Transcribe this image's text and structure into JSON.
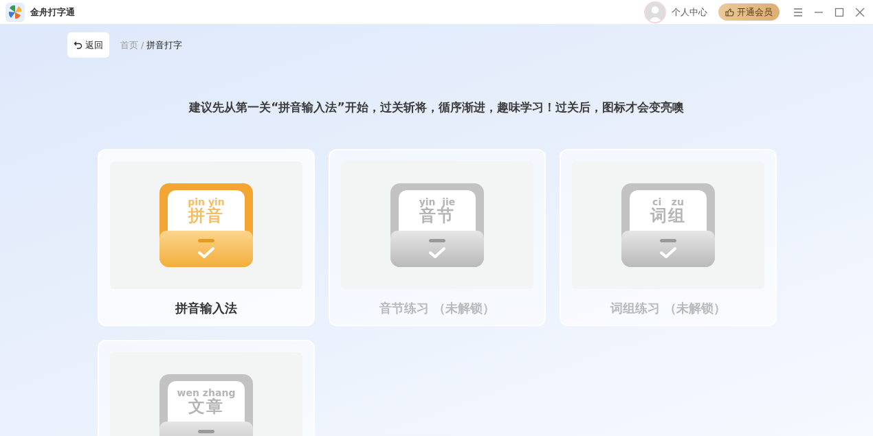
{
  "app": {
    "title": "金舟打字通"
  },
  "header": {
    "user_label": "个人中心",
    "vip_button": "开通会员"
  },
  "back_button": "返回",
  "breadcrumb_separator": "/",
  "breadcrumb": [
    {
      "label": "首页",
      "current": false
    },
    {
      "label": "拼音打字",
      "current": true
    }
  ],
  "hint": "建议先从第一关“拼音输入法”开始，过关斩将，循序渐进，趣味学习！过关后，图标才会变亮噢",
  "levels": [
    {
      "pinyin": "pin yin",
      "hanzi": "拼音",
      "title": "拼音输入法",
      "unlocked": true
    },
    {
      "pinyin": "yin  jie",
      "hanzi": "音节",
      "title": "音节练习 （未解锁）",
      "unlocked": false
    },
    {
      "pinyin": "ci   zu",
      "hanzi": "词组",
      "title": "词组练习 （未解锁）",
      "unlocked": false
    },
    {
      "pinyin": "wen zhang",
      "hanzi": "文章",
      "unlocked": false
    }
  ]
}
